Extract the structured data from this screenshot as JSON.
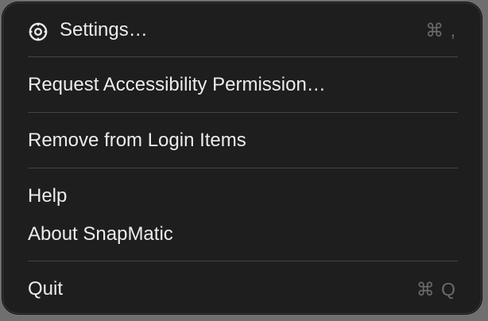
{
  "menu": {
    "items": [
      {
        "label": "Settings…",
        "shortcut": "⌘ ,",
        "icon": "gear-icon"
      },
      {
        "label": "Request Accessibility Permission…"
      },
      {
        "label": "Remove from Login Items"
      },
      {
        "label": "Help"
      },
      {
        "label": "About SnapMatic"
      },
      {
        "label": "Quit",
        "shortcut": "⌘ Q"
      }
    ]
  },
  "colors": {
    "menu_background": "#1e1e1e",
    "text": "#ececec",
    "shortcut_text": "#6a6a6a",
    "separator": "#444444"
  }
}
